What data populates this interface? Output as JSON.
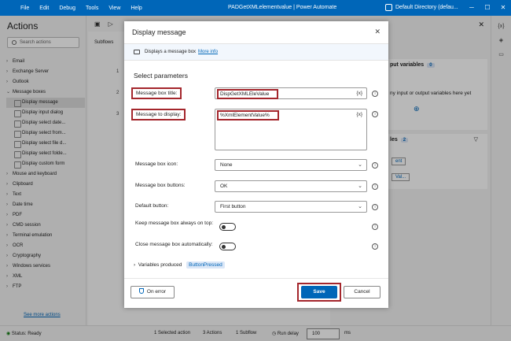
{
  "titlebar": {
    "menu": [
      "File",
      "Edit",
      "Debug",
      "Tools",
      "View",
      "Help"
    ],
    "title": "PADGetXMLelementvalue | Power Automate",
    "directory": "Default Directory (defau..."
  },
  "actions": {
    "header": "Actions",
    "search_placeholder": "Search actions",
    "tree": [
      {
        "label": "Email",
        "kind": "cat"
      },
      {
        "label": "Exchange Server",
        "kind": "cat"
      },
      {
        "label": "Outlook",
        "kind": "cat"
      },
      {
        "label": "Message boxes",
        "kind": "open"
      },
      {
        "label": "Display message",
        "kind": "sub",
        "selected": true
      },
      {
        "label": "Display input dialog",
        "kind": "sub"
      },
      {
        "label": "Display select date...",
        "kind": "sub"
      },
      {
        "label": "Display select from...",
        "kind": "sub"
      },
      {
        "label": "Display select file d...",
        "kind": "sub"
      },
      {
        "label": "Display select folde...",
        "kind": "sub"
      },
      {
        "label": "Display custom form",
        "kind": "sub"
      },
      {
        "label": "Mouse and keyboard",
        "kind": "cat"
      },
      {
        "label": "Clipboard",
        "kind": "cat"
      },
      {
        "label": "Text",
        "kind": "cat"
      },
      {
        "label": "Date time",
        "kind": "cat"
      },
      {
        "label": "PDF",
        "kind": "cat"
      },
      {
        "label": "CMD session",
        "kind": "cat"
      },
      {
        "label": "Terminal emulation",
        "kind": "cat"
      },
      {
        "label": "OCR",
        "kind": "cat"
      },
      {
        "label": "Cryptography",
        "kind": "cat"
      },
      {
        "label": "Windows services",
        "kind": "cat"
      },
      {
        "label": "XML",
        "kind": "cat"
      },
      {
        "label": "FTP",
        "kind": "cat"
      }
    ],
    "see_more": "See more actions"
  },
  "designer": {
    "subflows": "Subflows",
    "line_numbers": [
      "1",
      "2",
      "3"
    ]
  },
  "variables": {
    "io_title": "put variables",
    "io_count": "0",
    "io_empty": "ny input or output variables here yet",
    "flow_title": "les",
    "flow_count": "2",
    "chip1": "ent",
    "chip2": "Val..."
  },
  "status": {
    "ready": "Status: Ready",
    "selected": "1 Selected action",
    "actions": "3 Actions",
    "subflow": "1 Subflow",
    "run_delay_label": "Run delay",
    "run_delay_value": "100",
    "unit": "ms"
  },
  "dialog": {
    "title": "Display message",
    "banner_text": "Displays a message box",
    "banner_link": "More info",
    "section": "Select parameters",
    "title_label": "Message box title:",
    "title_value": "DispGetXMLEleValue",
    "message_label": "Message to display:",
    "message_value": "%XmlElementValue%",
    "fx": "{x}",
    "icon_label": "Message box icon:",
    "icon_value": "None",
    "buttons_label": "Message box buttons:",
    "buttons_value": "OK",
    "default_label": "Default button:",
    "default_value": "First button",
    "keep_top_label": "Keep message box always on top:",
    "keep_top_on": false,
    "auto_close_label": "Close message box automatically:",
    "auto_close_on": false,
    "vars_produced_label": "Variables produced",
    "vars_produced_value": "ButtonPressed",
    "on_error": "On error",
    "save": "Save",
    "cancel": "Cancel"
  },
  "colors": {
    "accent": "#0066b8",
    "highlight_border": "#a4262c"
  }
}
